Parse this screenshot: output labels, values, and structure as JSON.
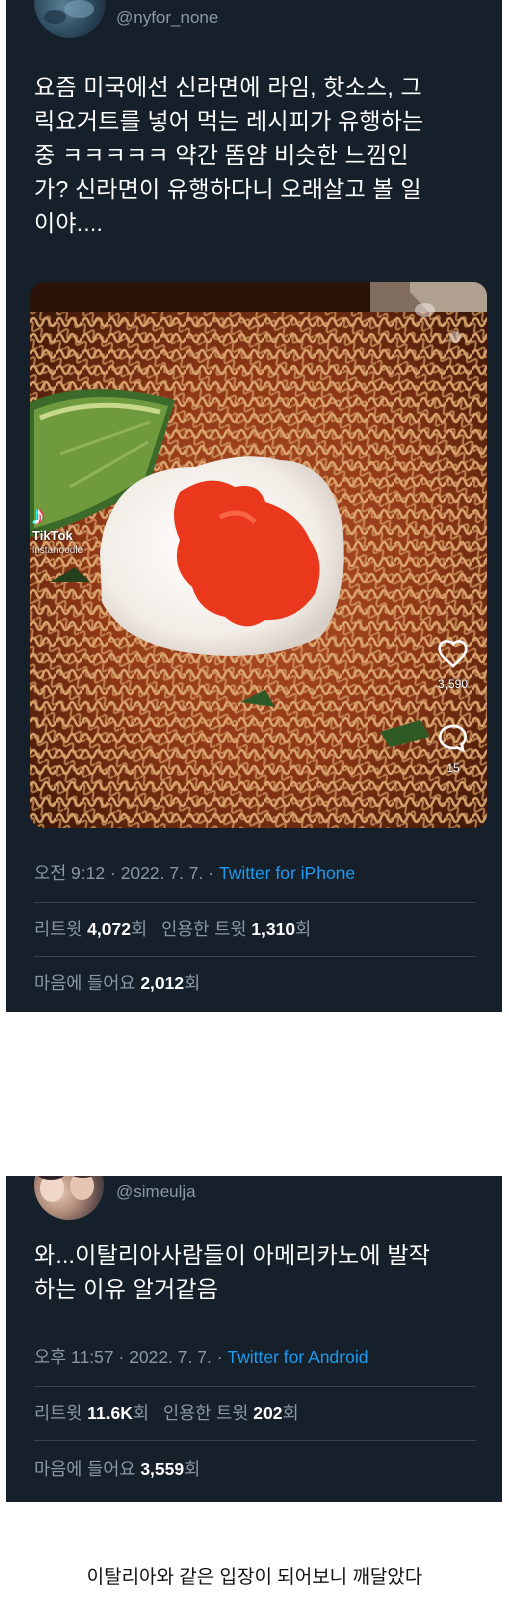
{
  "tweet1": {
    "handle": "@nyfor_none",
    "body_lines": [
      "요즘 미국에선 신라면에 라임, 핫소스, 그",
      "릭요거트를 넣어 먹는 레시피가 유행하는",
      "중 ㅋㅋㅋㅋㅋ 약간 똠얌 비슷한 느낌인",
      "가? 신라면이 유행하다니 오래살고 볼 일",
      "이야...."
    ],
    "media": {
      "tiktok_brand": "TikTok",
      "tiktok_user": "instanoodle",
      "like_count": "3,590",
      "comment_count": "15",
      "icons": [
        "tiktok-logo",
        "heart-icon",
        "comment-icon"
      ]
    },
    "time": "오전 9:12",
    "sep1": " · ",
    "date": "2022. 7. 7.",
    "sep2": " · ",
    "source": "Twitter for iPhone",
    "retweet_label": "리트윗 ",
    "retweet_count": "4,072",
    "retweet_unit": "회",
    "quote_label": "인용한 트윗 ",
    "quote_count": "1,310",
    "quote_unit": "회",
    "like_label": "마음에 들어요 ",
    "like_count": "2,012",
    "like_unit": "회"
  },
  "tweet2": {
    "handle": "@simeulja",
    "body_lines": [
      "와...이탈리아사람들이 아메리카노에 발작",
      "하는 이유 알거같음"
    ],
    "time": "오후 11:57",
    "sep1": " · ",
    "date": "2022. 7. 7.",
    "sep2": " · ",
    "source": "Twitter for Android",
    "retweet_label": "리트윗 ",
    "retweet_count": "11.6K",
    "retweet_unit": "회",
    "quote_label": "인용한 트윗 ",
    "quote_count": "202",
    "quote_unit": "회",
    "like_label": "마음에 들어요 ",
    "like_count": "3,559",
    "like_unit": "회"
  },
  "caption": "이탈리아와 같은 입장이 되어보니 깨달았다",
  "colors": {
    "card_bg": "#15202b",
    "muted_text": "#8b98a5",
    "link": "#1d9bf0",
    "divider": "#38444d",
    "page_bg": "#ffffff"
  }
}
